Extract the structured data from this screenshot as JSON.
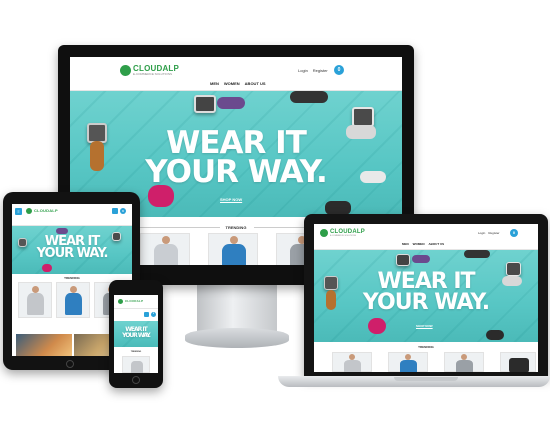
{
  "site": {
    "logo_text": "CLOUDALP",
    "logo_sub": "E-COMMERCE SOLUTIONS",
    "nav": [
      "MEN",
      "WOMEN",
      "ABOUT US"
    ],
    "login": "Login",
    "register": "Register",
    "cart_count": "0"
  },
  "hero": {
    "line1": "WEAR IT",
    "line2": "YOUR WAY.",
    "cta": "SHOP NOW"
  },
  "trending": {
    "label": "TRENDING"
  },
  "colors": {
    "brand_green": "#2e9e49",
    "hero_teal": "#57c6c4",
    "accent_blue": "#2aa1d8"
  }
}
